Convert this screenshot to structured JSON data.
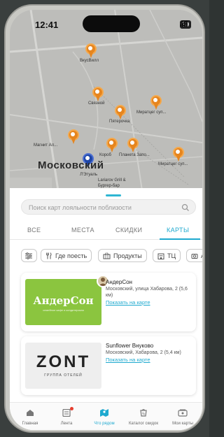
{
  "status_bar": {
    "time": "12:41",
    "battery": "89"
  },
  "map": {
    "district": "Московский",
    "labels": [
      "ВкусВилл",
      "Связной",
      "Пятерочка",
      "Миратцег суп...",
      "Короб",
      "Планета Запо...",
      "Миратцег суп...",
      "Магнит Ал...",
      "Л'Этуаль",
      "Lariarov Grill &",
      "Бургер-бар"
    ]
  },
  "search": {
    "placeholder": "Поиск карт лояльности поблизости"
  },
  "tabs": [
    {
      "label": "ВСЕ"
    },
    {
      "label": "МЕСТА"
    },
    {
      "label": "СКИДКИ"
    },
    {
      "label": "КАРТЫ"
    }
  ],
  "filters": [
    {
      "label": "Где поесть"
    },
    {
      "label": "Продукты"
    },
    {
      "label": "ТЦ"
    },
    {
      "label": "Ап"
    }
  ],
  "cards": [
    {
      "title": "АндерСон",
      "address": "Московский, улица Хабарова, 2 (5,6 км)",
      "link": "Показать на карте",
      "logo_text": "АндерСон",
      "logo_sub": "семейное кафе и кондитерская"
    },
    {
      "title": "Sunflower Внуково",
      "address": "Московский, Хабарова, 2 (5,4 км)",
      "link": "Показать на карте",
      "logo_text": "ZONT",
      "logo_sub": "ГРУППА ОТЕЛЕЙ"
    }
  ],
  "nav": [
    {
      "label": "Главная",
      "icon": "home-icon"
    },
    {
      "label": "Лента",
      "icon": "feed-icon"
    },
    {
      "label": "Что рядом",
      "icon": "map-icon"
    },
    {
      "label": "Каталог скидок",
      "icon": "catalog-icon"
    },
    {
      "label": "Мои карты",
      "icon": "cards-icon"
    }
  ],
  "colors": {
    "accent": "#1ea9cf",
    "pin": "#e6851e",
    "anderson_green": "#8bc53f"
  }
}
